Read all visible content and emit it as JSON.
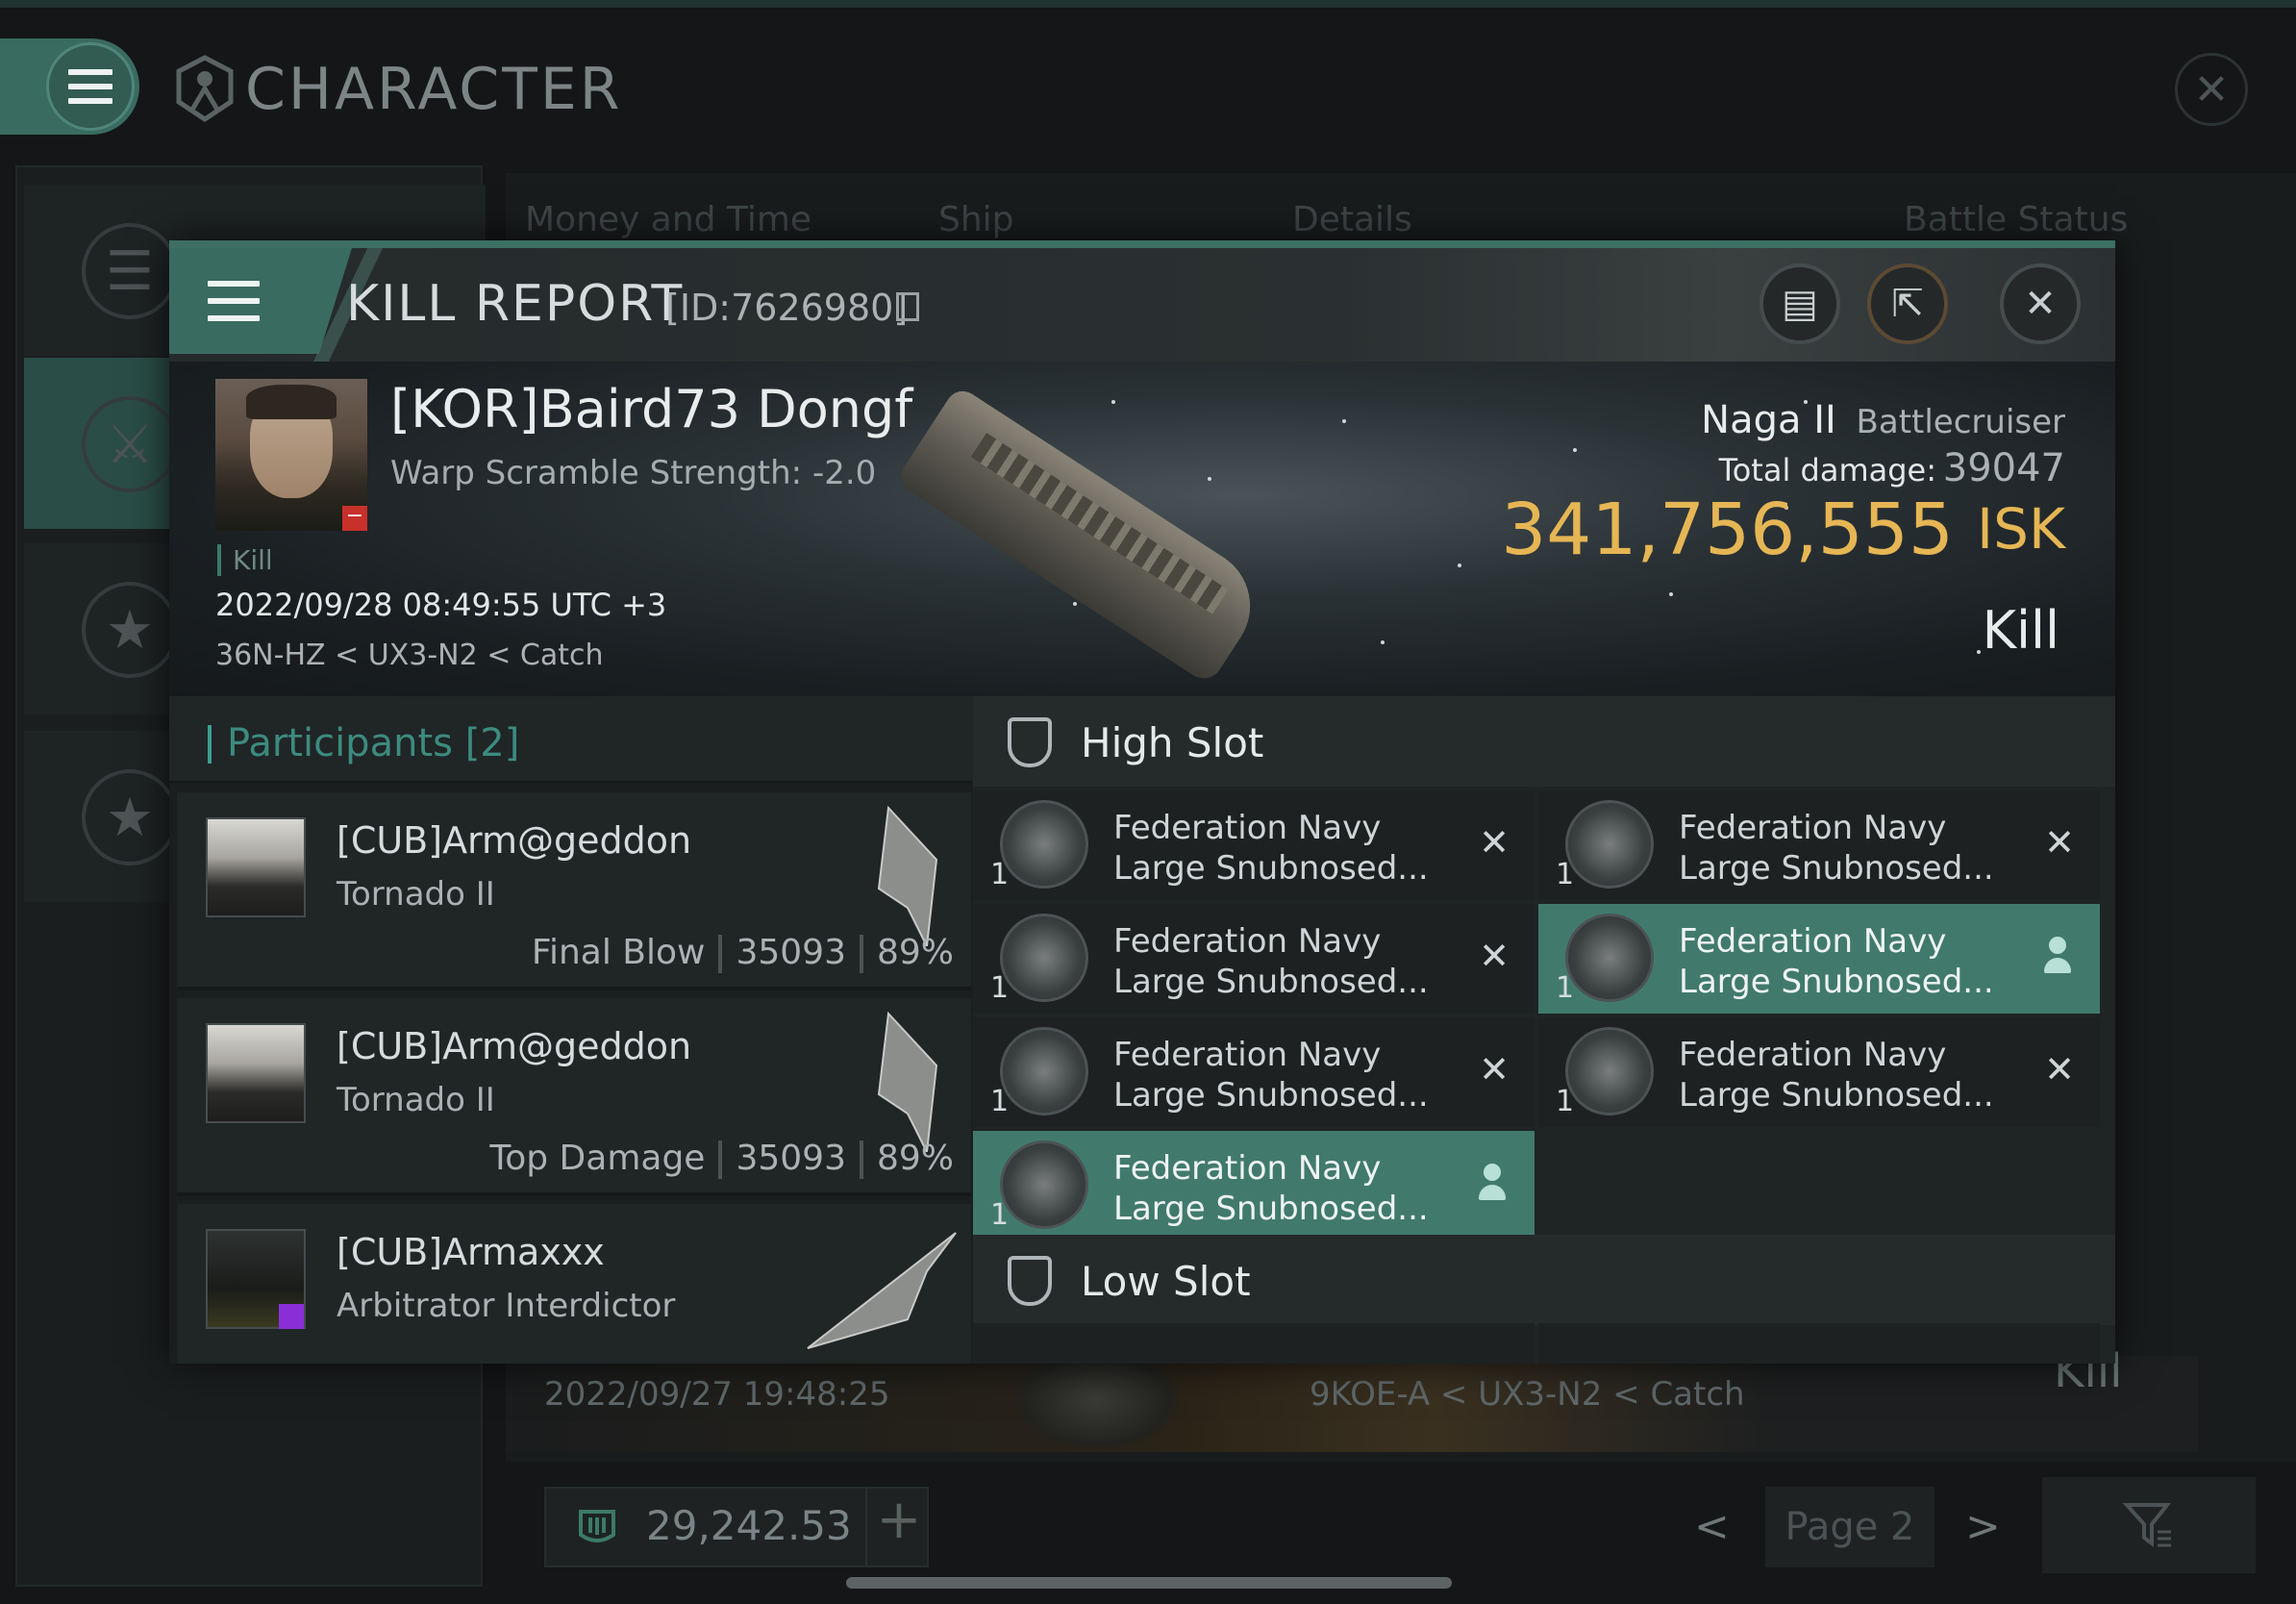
{
  "window": {
    "title": "CHARACTER",
    "close_glyph": "✕"
  },
  "background": {
    "columns": [
      "Money and Time",
      "Ship",
      "Details",
      "Battle Status"
    ],
    "row": {
      "date": "2022/09/27  19:48:25",
      "location": "9KOE-A < UX3-N2 < Catch",
      "status": "Kill"
    },
    "wallet": {
      "amount": "29,242.53",
      "plus": "+"
    },
    "pager": {
      "prev": "<",
      "label": "Page 2",
      "next": ">"
    },
    "filter_icon": "filter-icon"
  },
  "sidebar": {
    "items": [
      {
        "name": "menu",
        "icon": "list-icon",
        "glyph": "☰"
      },
      {
        "name": "combat",
        "icon": "crossed-swords-icon",
        "glyph": "⚔"
      },
      {
        "name": "star-badge",
        "icon": "star-shield-icon",
        "glyph": "★"
      },
      {
        "name": "star-circle",
        "icon": "star-circle-icon",
        "glyph": "★"
      }
    ]
  },
  "kill_report": {
    "title": "KILL REPORT",
    "id": "[ID:7626980]",
    "buttons": {
      "clip": "▤",
      "share": "⇱",
      "close": "✕"
    },
    "victim": {
      "name": "[KOR]Baird73 Dongf",
      "warp_scramble": "Warp Scramble Strength: -2.0",
      "tag": "Kill",
      "time": "2022/09/28 08:49:55 UTC +3",
      "location": "36N-HZ < UX3-N2 < Catch"
    },
    "ship": {
      "name": "Naga II",
      "class": "Battlecruiser",
      "total_damage_label": "Total damage:",
      "total_damage": "39047",
      "isk_value": "341,756,555",
      "isk_unit": "ISK",
      "result": "Kill"
    },
    "participants": {
      "label": "Participants",
      "count": "[2]",
      "list": [
        {
          "name": "[CUB]Arm@geddon",
          "ship": "Tornado II",
          "role": "Final Blow",
          "damage": "35093",
          "percent": "89%"
        },
        {
          "name": "[CUB]Arm@geddon",
          "ship": "Tornado II",
          "role": "Top Damage",
          "damage": "35093",
          "percent": "89%"
        },
        {
          "name": "[CUB]Armaxxx",
          "ship": "Arbitrator Interdictor",
          "role": "",
          "damage": "",
          "percent": ""
        }
      ]
    },
    "high_slot": {
      "title": "High Slot",
      "modules": [
        {
          "line1": "Federation Navy",
          "line2": "Large Snubnosed...",
          "qty": "1",
          "status": "destroyed"
        },
        {
          "line1": "Federation Navy",
          "line2": "Large Snubnosed...",
          "qty": "1",
          "status": "destroyed"
        },
        {
          "line1": "Federation Navy",
          "line2": "Large Snubnosed...",
          "qty": "1",
          "status": "destroyed"
        },
        {
          "line1": "Federation Navy",
          "line2": "Large Snubnosed...",
          "qty": "1",
          "status": "dropped"
        },
        {
          "line1": "Federation Navy",
          "line2": "Large Snubnosed...",
          "qty": "1",
          "status": "destroyed"
        },
        {
          "line1": "Federation Navy",
          "line2": "Large Snubnosed...",
          "qty": "1",
          "status": "destroyed"
        },
        {
          "line1": "Federation Navy",
          "line2": "Large Snubnosed...",
          "qty": "1",
          "status": "dropped"
        }
      ]
    },
    "low_slot": {
      "title": "Low Slot"
    },
    "colors": {
      "accent": "#3c7a68",
      "isk": "#e6b655",
      "active_row": "#417a6d"
    }
  }
}
